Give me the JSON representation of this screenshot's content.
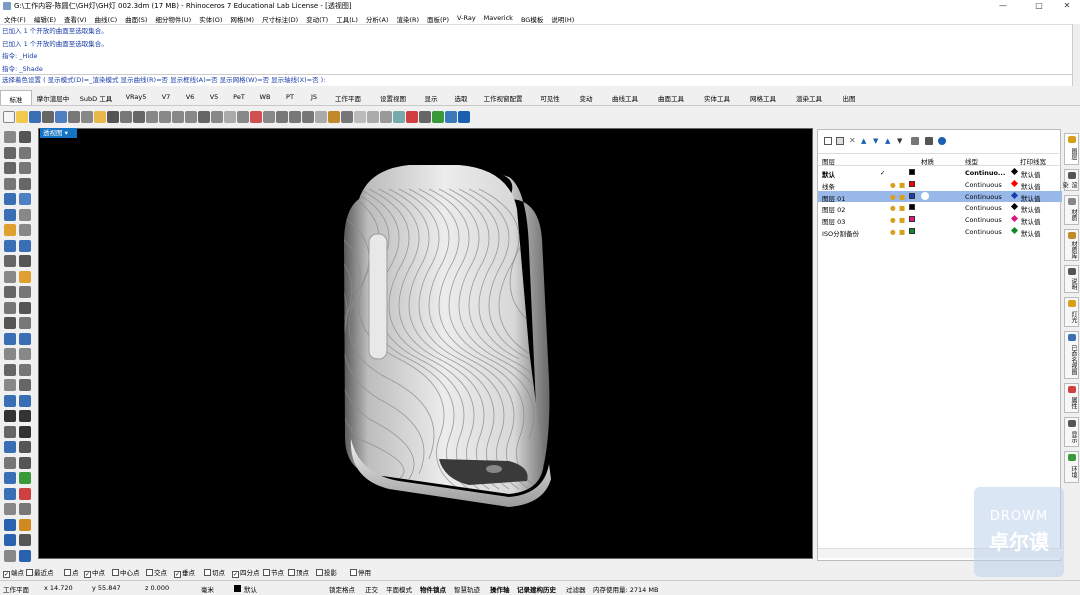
{
  "window": {
    "title": "G:\\工作内容-陈圆仁\\GH灯\\GH灯 002.3dm (17 MB) - Rhinoceros 7 Educational Lab License - [透视图]",
    "min": "—",
    "max": "□",
    "close": "✕"
  },
  "menu": [
    "文件(F)",
    "编辑(E)",
    "查看(V)",
    "曲线(C)",
    "曲面(S)",
    "细分物件(U)",
    "实体(O)",
    "网格(M)",
    "尺寸标注(D)",
    "变动(T)",
    "工具(L)",
    "分析(A)",
    "渲染(R)",
    "面板(P)",
    "V-Ray",
    "Maverick",
    "BG模板",
    "说明(H)"
  ],
  "history": [
    "已加入 1 个开放的曲面至选取集合。",
    "已加入 1 个开放的曲面至选取集合。",
    "指令: _Hide",
    "指令: _Shade"
  ],
  "command_prompt": "选择着色设置 ( 显示模式(D)=_渲染模式  显示曲线(R)=否  显示框线(A)=否  显示网格(W)=否  显示轴线(X)=否 ):",
  "tabs": [
    "标准",
    "摩尔渲层中",
    "SubD 工具",
    "VRay5",
    "V7",
    "V6",
    "V5",
    "PeT",
    "WB",
    "PT",
    "JS",
    "工作平面",
    "设置视图",
    "显示",
    "选取",
    "工作视窗配置",
    "可见性",
    "变动",
    "曲线工具",
    "曲面工具",
    "实体工具",
    "网格工具",
    "渲染工具",
    "出图"
  ],
  "active_tab": "标准",
  "viewport": {
    "label": "透视图"
  },
  "layers_panel": {
    "headers": {
      "name": "图层",
      "material": "材质",
      "linetype": "线型",
      "print_color": "打印线宽"
    },
    "rows": [
      {
        "name": "默认",
        "check": "✓",
        "color": "#000000",
        "linetype": "Continuo...",
        "print_color": "#000000",
        "print": "默认值",
        "selected": false,
        "bold": true
      },
      {
        "name": "线条",
        "check": "",
        "color": "#ff0000",
        "linetype": "Continuous",
        "print_color": "#ff0000",
        "print": "默认值",
        "selected": false,
        "bold": false
      },
      {
        "name": "图层 01",
        "check": "",
        "color": "#1a3ea8",
        "linetype": "Continuous",
        "print_color": "#1a3ea8",
        "print": "默认值",
        "selected": true,
        "bold": false
      },
      {
        "name": "图层 02",
        "check": "",
        "color": "#000000",
        "linetype": "Continuous",
        "print_color": "#000000",
        "print": "默认值",
        "selected": false,
        "bold": false
      },
      {
        "name": "图层 03",
        "check": "",
        "color": "#e0157f",
        "linetype": "Continuous",
        "print_color": "#e0157f",
        "print": "默认值",
        "selected": false,
        "bold": false
      },
      {
        "name": "ISO分割备份",
        "check": "",
        "color": "#0f8a2a",
        "linetype": "Continuous",
        "print_color": "#0f8a2a",
        "print": "默认值",
        "selected": false,
        "bold": false
      }
    ]
  },
  "right_tabs": [
    "图层",
    "渲染",
    "材质",
    "材质库",
    "说明",
    "灯光",
    "已命名视图",
    "属性",
    "显示",
    "环境"
  ],
  "osnap": [
    {
      "label": "端点",
      "checked": true
    },
    {
      "label": "最近点",
      "checked": false
    },
    {
      "label": "点",
      "checked": false
    },
    {
      "label": "中点",
      "checked": true
    },
    {
      "label": "中心点",
      "checked": false
    },
    {
      "label": "交点",
      "checked": false
    },
    {
      "label": "垂点",
      "checked": true
    },
    {
      "label": "切点",
      "checked": false
    },
    {
      "label": "四分点",
      "checked": true
    },
    {
      "label": "节点",
      "checked": false
    },
    {
      "label": "顶点",
      "checked": false
    },
    {
      "label": "投影",
      "checked": false
    },
    {
      "label": "停用",
      "checked": false
    }
  ],
  "status": {
    "cplane": "工作平面",
    "x": "x 14.720",
    "y": "y 55.847",
    "z": "z 0.000",
    "unit": "毫米",
    "layer": "默认",
    "lock_grid": "锁定格点",
    "ortho": "正交",
    "planar": "平面模式",
    "osnap": "物件锁点",
    "smarttrack": "智慧轨迹",
    "gumball": "操作轴",
    "history": "记录建构历史",
    "filter": "过滤器",
    "memory": "内存使用量: 2714 MB"
  },
  "watermark": {
    "line1": "DROWM",
    "line2": "卓尔谟"
  },
  "colors": {
    "accent": "#1573c4",
    "selection": "#99b8ea",
    "command_text": "#1a3ea8"
  }
}
